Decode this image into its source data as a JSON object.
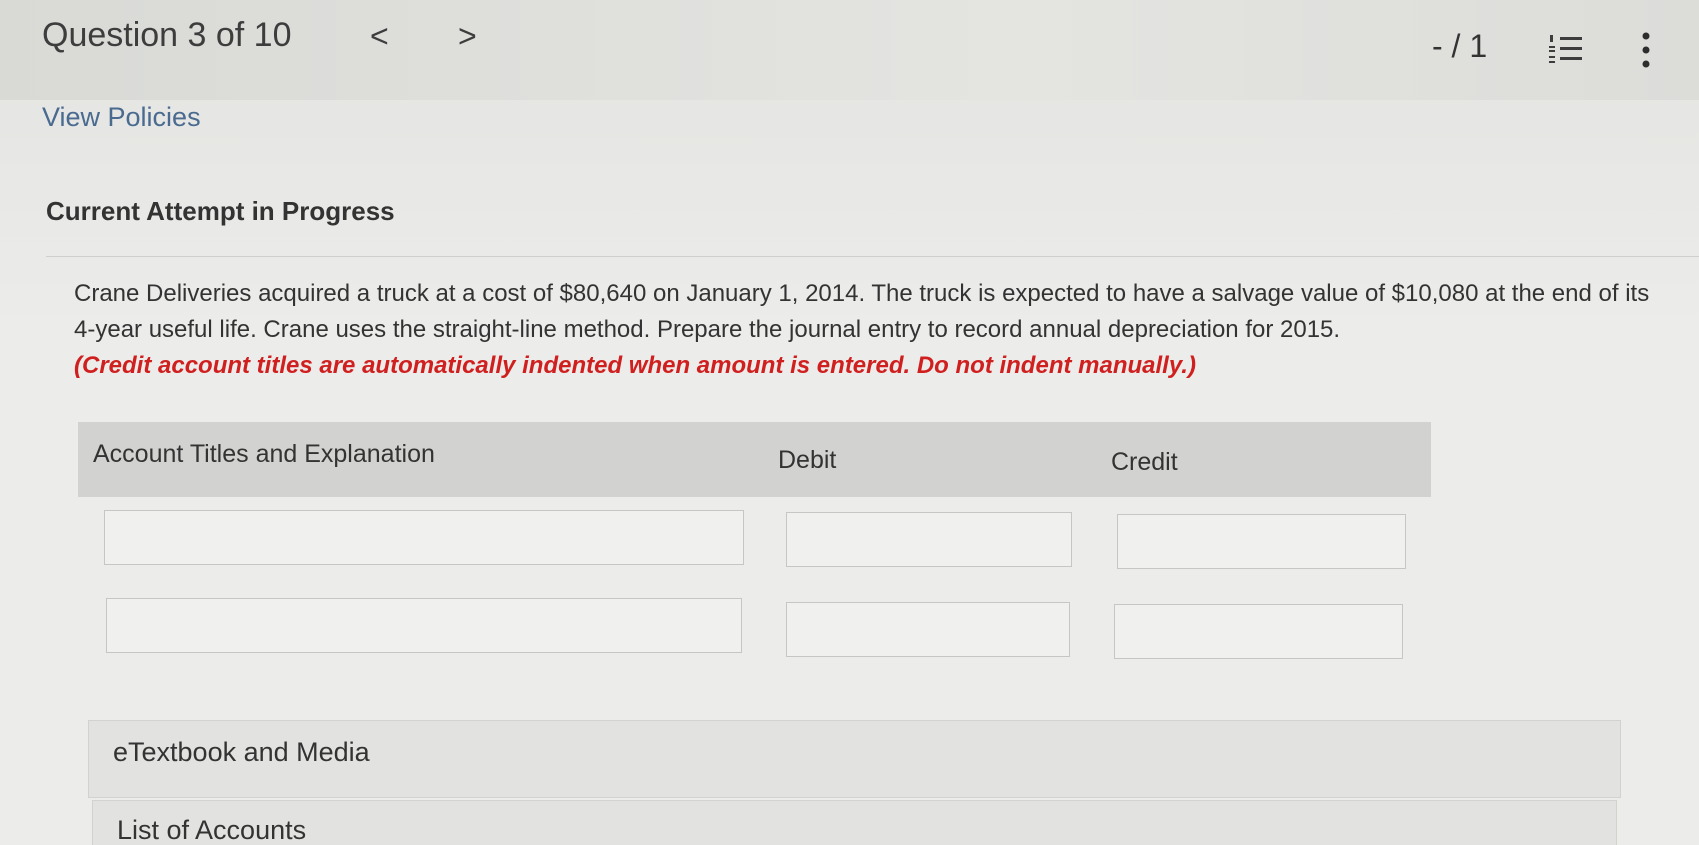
{
  "header": {
    "question_title": "Question 3 of 10",
    "prev_arrow": "<",
    "next_arrow": ">",
    "score": "- / 1"
  },
  "links": {
    "view_policies": "View Policies"
  },
  "attempt": {
    "label": "Current Attempt in Progress"
  },
  "question": {
    "text": "Crane Deliveries acquired a truck at a cost of $80,640 on January 1, 2014. The truck is expected to have a salvage value of $10,080 at the end of its 4-year useful life. Crane uses the straight-line method. Prepare the journal entry to record annual depreciation for 2015.",
    "note": "(Credit account titles are automatically indented when amount is entered. Do not indent manually.)"
  },
  "journal": {
    "columns": [
      "Account Titles and Explanation",
      "Debit",
      "Credit"
    ],
    "rows": [
      {
        "account": "",
        "debit": "",
        "credit": ""
      },
      {
        "account": "",
        "debit": "",
        "credit": ""
      }
    ]
  },
  "panels": {
    "etextbook": "eTextbook and Media",
    "list_of_accounts": "List of Accounts"
  },
  "icons": {
    "list": "numbered-list-icon",
    "more": "vertical-ellipsis-icon"
  }
}
